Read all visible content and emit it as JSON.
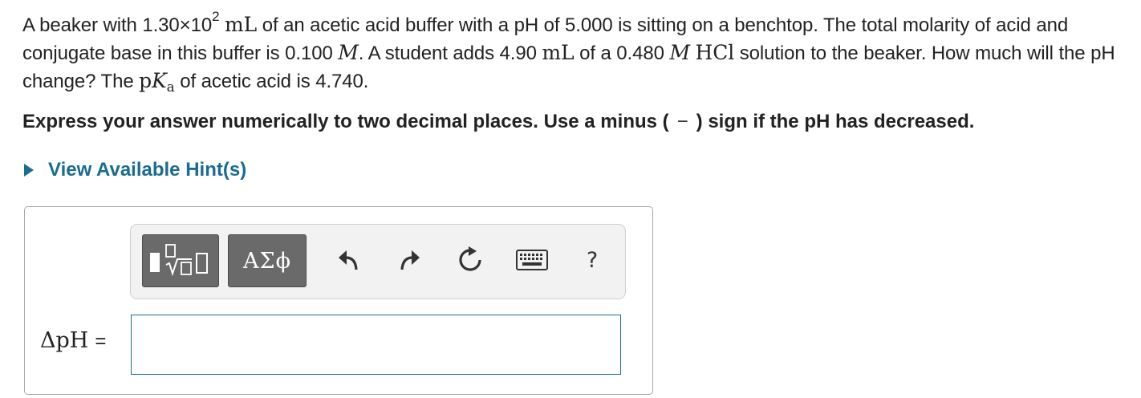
{
  "question": {
    "p1": "A beaker with ",
    "volume_mantissa": "1.30×10",
    "volume_exp": "2",
    "unit_ml": "mL",
    "p2": " of an acetic acid buffer with a pH of 5.000 is sitting on a benchtop. The total molarity of acid and conjugate base in this buffer is 0.100 ",
    "unit_M": "M",
    "p3": ".  A student adds 4.90 ",
    "unit_ml_2": "mL",
    "p4": " of a 0.480 ",
    "unit_M_2": "M",
    "hcl": "HCl",
    "p5": " solution to the beaker. How much will the pH change? The ",
    "pka_p": "p",
    "pka_K": "K",
    "pka_sub": "a",
    "p6": " of acetic acid is 4.740."
  },
  "instruction": {
    "before": "Express your answer numerically to two decimal places. Use a minus (",
    "minus": "−",
    "after": ") sign if the pH has decreased."
  },
  "hint": {
    "label": "View Available Hint(s)"
  },
  "toolbar": {
    "greek_label": "ΑΣϕ",
    "help_label": "?",
    "colors": {
      "button_bg": "#6a6a6a",
      "toolbar_bg": "#f2f2f2",
      "accent": "#1a6d8e"
    },
    "icons": [
      "templates-icon",
      "greek-letters-icon",
      "undo-icon",
      "redo-icon",
      "reset-icon",
      "keyboard-icon",
      "help-icon"
    ]
  },
  "answer": {
    "label": "ΔpH",
    "equals": "=",
    "value": ""
  }
}
